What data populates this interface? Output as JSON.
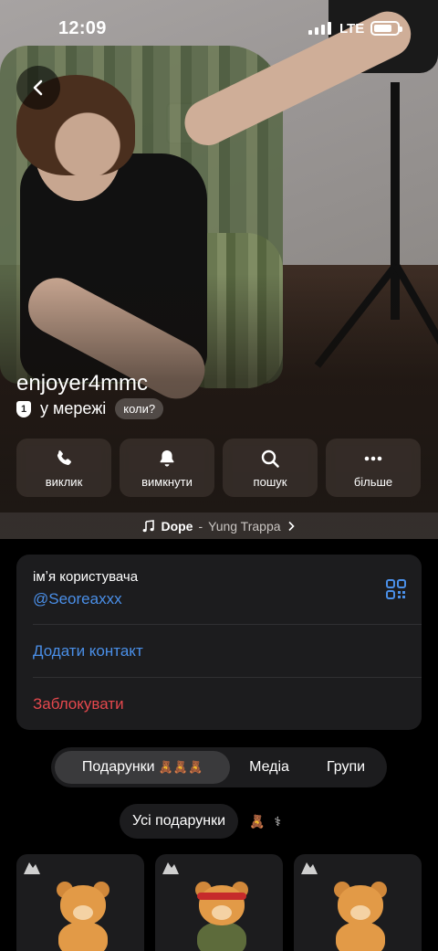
{
  "status_bar": {
    "time": "12:09",
    "network": "LTE"
  },
  "profile": {
    "display_name": "enjoyer4mmc",
    "status_badge": "1",
    "status_text": "у мережі",
    "when_label": "коли?"
  },
  "actions": [
    {
      "label": "виклик",
      "icon": "phone-icon"
    },
    {
      "label": "вимкнути",
      "icon": "bell-icon"
    },
    {
      "label": "пошук",
      "icon": "search-icon"
    },
    {
      "label": "більше",
      "icon": "more-icon"
    }
  ],
  "now_playing": {
    "title": "Dope",
    "separator": "-",
    "artist": "Yung Trappa"
  },
  "info": {
    "username_label": "імʼя користувача",
    "username_value": "@Seoreaxxx",
    "add_contact": "Додати контакт",
    "block": "Заблокувати"
  },
  "tabs": {
    "gifts": "Подарунки",
    "gift_emojis": "🧸🧸🧸",
    "media": "Медіа",
    "groups": "Групи"
  },
  "filter": {
    "all_gifts": "Усі подарунки",
    "extra_emoji": "🧸",
    "extra_symbol": "⚕"
  },
  "gifts": [
    {
      "name": "bear",
      "variant": "plain"
    },
    {
      "name": "bear",
      "variant": "headband"
    },
    {
      "name": "bear",
      "variant": "plain"
    }
  ],
  "colors": {
    "accent_blue": "#4a8fe8",
    "danger_red": "#e5484d",
    "card_bg": "#1c1c1e"
  }
}
